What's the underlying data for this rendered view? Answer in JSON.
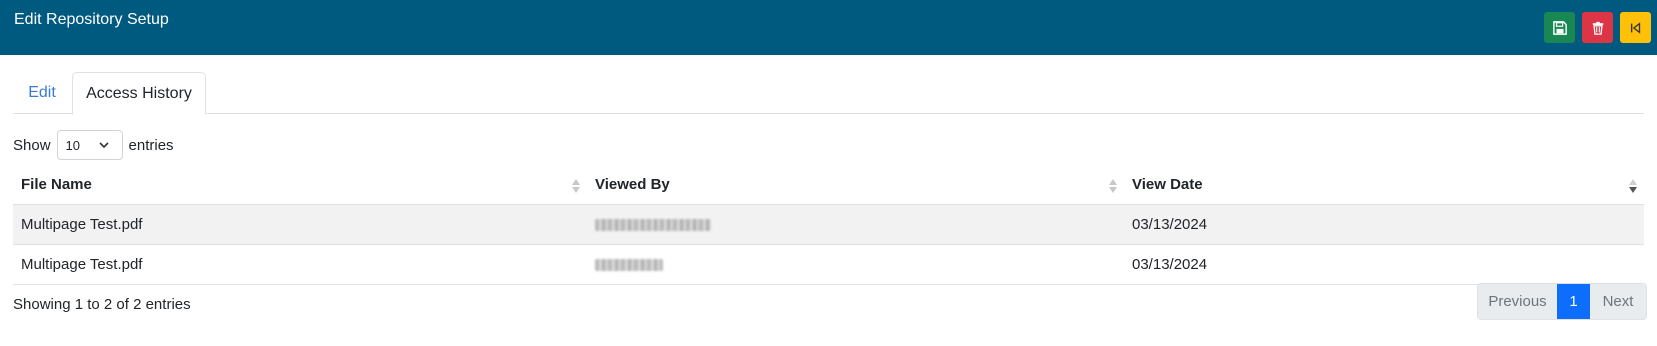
{
  "header": {
    "title": "Edit Repository Setup",
    "buttons": [
      {
        "name": "save-button",
        "icon": "save-icon",
        "color": "#198754"
      },
      {
        "name": "delete-button",
        "icon": "trash-icon",
        "color": "#dc3545"
      },
      {
        "name": "back-button",
        "icon": "back-icon",
        "color": "#ffc107"
      }
    ]
  },
  "tabs": [
    {
      "label": "Edit",
      "active": false
    },
    {
      "label": "Access History",
      "active": true
    }
  ],
  "length_menu": {
    "prefix": "Show",
    "value": "10",
    "suffix": "entries"
  },
  "table": {
    "columns": [
      "File Name",
      "Viewed By",
      "View Date"
    ],
    "sorted_column": "View Date",
    "sort_direction": "desc",
    "rows": [
      {
        "file_name": "Multipage Test.pdf",
        "viewed_by": "",
        "view_date": "03/13/2024"
      },
      {
        "file_name": "Multipage Test.pdf",
        "viewed_by": "",
        "view_date": "03/13/2024"
      }
    ]
  },
  "info": "Showing 1 to 2 of 2 entries",
  "pagination": {
    "previous": "Previous",
    "current": "1",
    "next": "Next"
  }
}
